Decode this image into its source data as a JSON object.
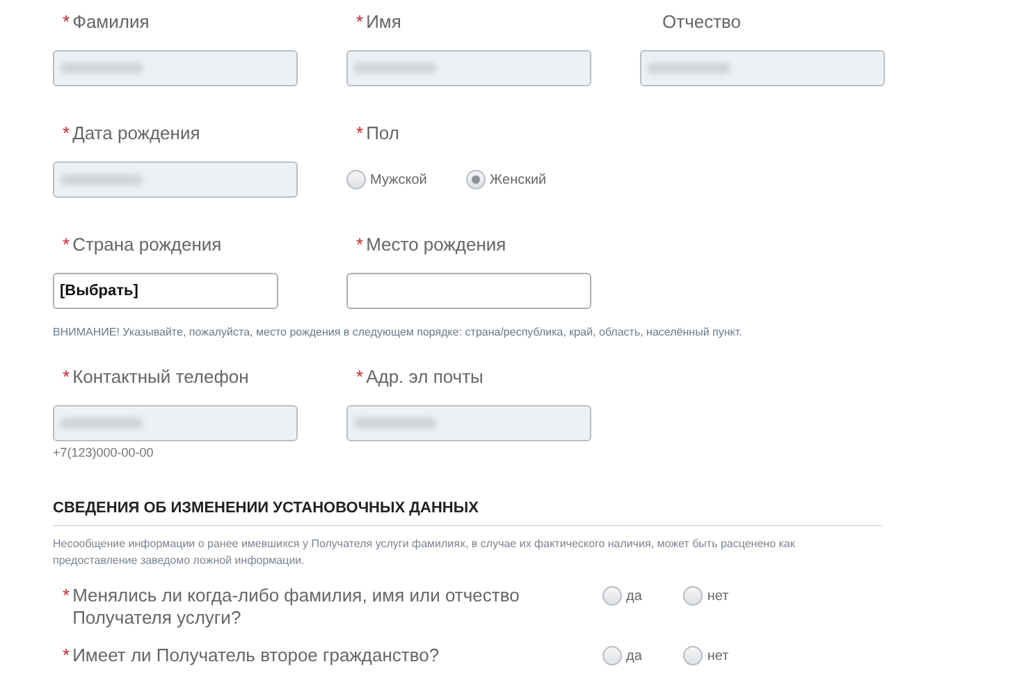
{
  "rows": [
    {
      "fields": [
        {
          "kind": "text",
          "label": "Фамилия",
          "mark": "*",
          "disabled": true,
          "blurred": true
        },
        {
          "kind": "text",
          "label": "Имя",
          "mark": "*",
          "disabled": true,
          "blurred": true
        },
        {
          "kind": "text",
          "label": "Отчество",
          "disabled": true,
          "blurred": true
        }
      ]
    },
    {
      "fields": [
        {
          "kind": "text",
          "label": "Дата рождения",
          "mark": "*",
          "disabled": true,
          "blurred": true
        },
        {
          "kind": "radio",
          "label": "Пол",
          "mark": "*",
          "options": [
            {
              "label": "Мужской",
              "selected": false
            },
            {
              "label": "Женский",
              "selected": true
            }
          ]
        }
      ]
    },
    {
      "fields": [
        {
          "kind": "select",
          "label": "Страна рождения",
          "mark": "*",
          "disabled": false,
          "value": "[Выбрать]"
        },
        {
          "kind": "text",
          "label": "Место рождения",
          "mark": "*",
          "disabled": false
        }
      ],
      "note": "ВНИМАНИЕ! Указывайте, пожалуйста, место рождения в следующем порядке: страна/республика, край, область, населённый пункт."
    },
    {
      "fields": [
        {
          "kind": "text",
          "label": "Контактный телефон",
          "mark": "*",
          "disabled": true,
          "blurred": true,
          "hint": "+7(123)000-00-00"
        },
        {
          "kind": "text",
          "label": "Адр. эл почты",
          "mark": "*",
          "disabled": true,
          "blurred": true
        }
      ]
    }
  ],
  "section": {
    "title": "СВЕДЕНИЯ ОБ ИЗМЕНЕНИИ УСТАНОВОЧНЫХ ДАННЫХ",
    "note": "Несообщение информации о ранее имевшихся у Получателя услуги фамилиях, в случае их фактического наличия, может быть расценено как предоставление заведомо ложной информации.",
    "questions": [
      {
        "text": "Менялись ли когда-либо фамилия, имя или отчество Получателя услуги?",
        "mark": "*",
        "options": [
          {
            "label": "да",
            "selected": false
          },
          {
            "label": "нет",
            "selected": false
          }
        ]
      },
      {
        "text": "Имеет ли Получатель второе гражданство?",
        "mark": "*",
        "options": [
          {
            "label": "да",
            "selected": false
          },
          {
            "label": "нет",
            "selected": false
          }
        ]
      }
    ]
  }
}
